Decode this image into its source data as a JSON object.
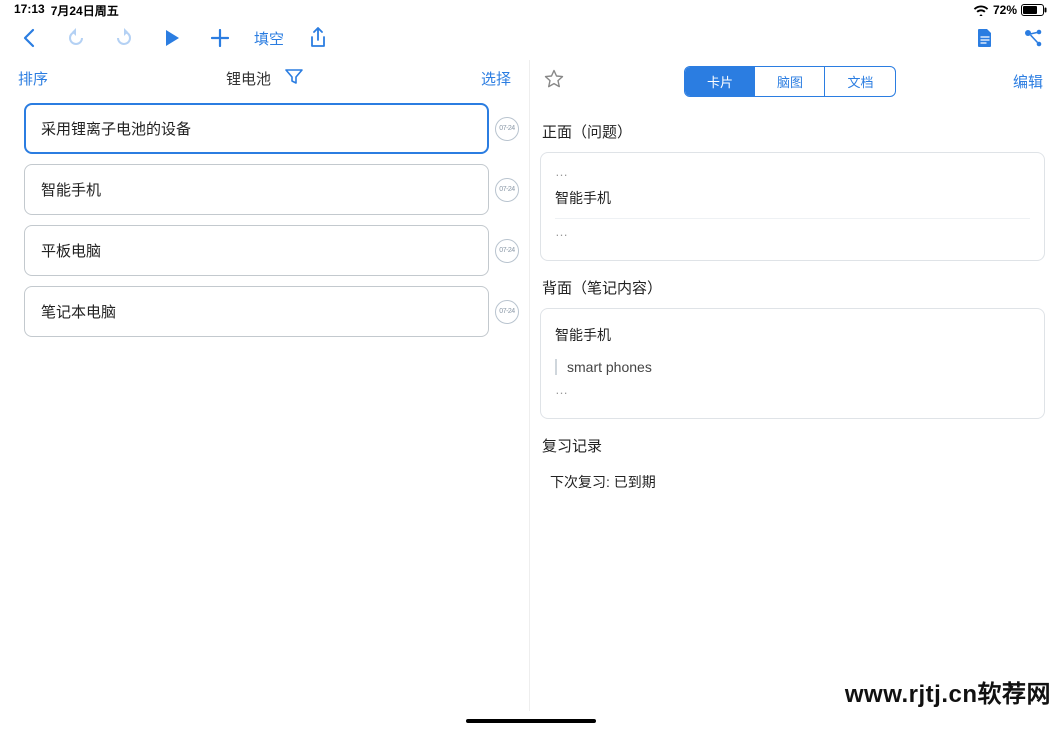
{
  "status": {
    "time": "17:13",
    "date": "7月24日周五",
    "battery": "72%"
  },
  "toolbar": {
    "fill_label": "填空"
  },
  "left": {
    "sort_label": "排序",
    "title": "锂电池",
    "select_label": "选择",
    "items": [
      {
        "label": "采用锂离子电池的设备",
        "date": "07-24",
        "selected": true
      },
      {
        "label": "智能手机",
        "date": "07-24",
        "selected": false
      },
      {
        "label": "平板电脑",
        "date": "07-24",
        "selected": false
      },
      {
        "label": "笔记本电脑",
        "date": "07-24",
        "selected": false
      }
    ]
  },
  "right": {
    "tabs": {
      "card": "卡片",
      "mindmap": "脑图",
      "doc": "文档"
    },
    "edit_label": "编辑",
    "front_label": "正面（问题）",
    "front_content": "智能手机",
    "back_label": "背面（笔记内容）",
    "back_title": "智能手机",
    "back_detail": "smart phones",
    "review_label": "复习记录",
    "review_next": "下次复习: 已到期"
  },
  "watermark": "www.rjtj.cn软荐网"
}
